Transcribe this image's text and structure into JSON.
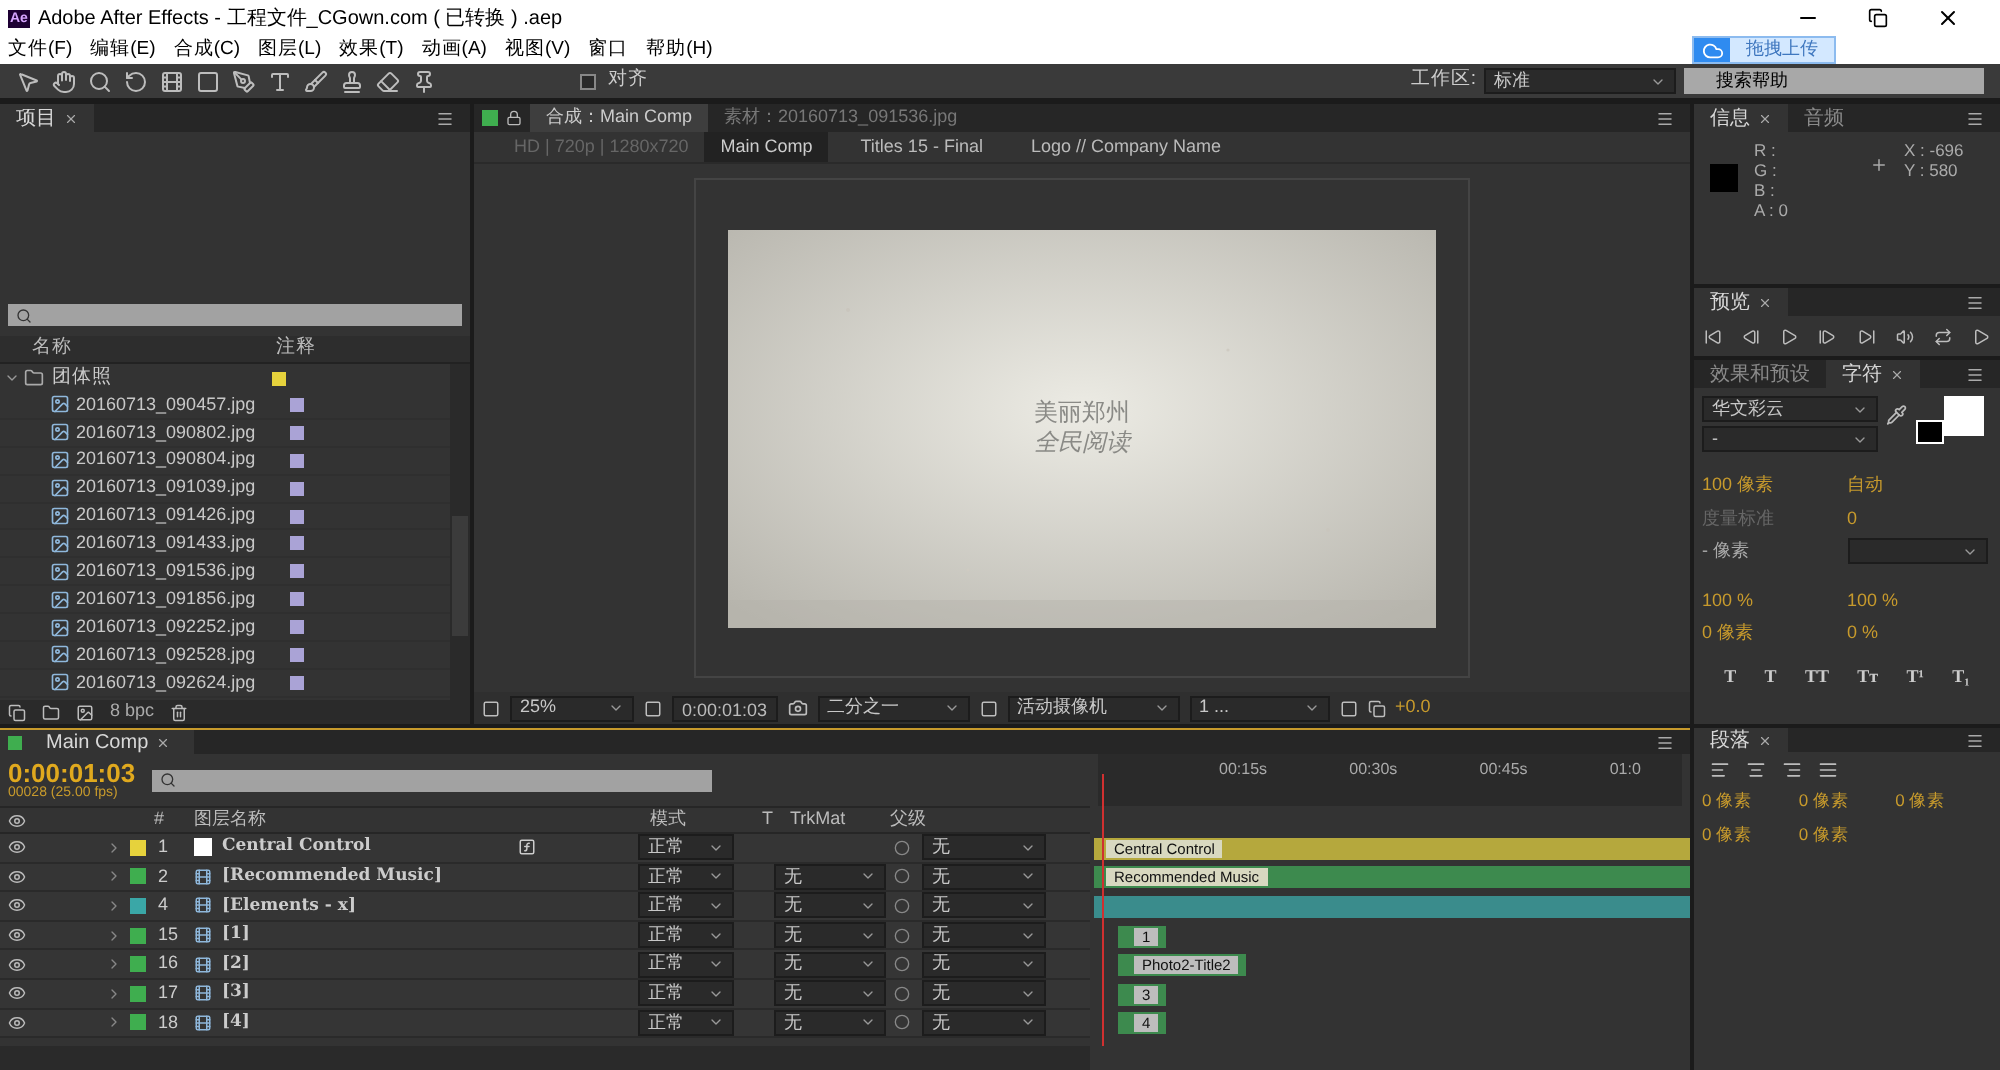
{
  "window": {
    "title": "Adobe After Effects - 工程文件_CGown.com ( 已转换 ) .aep",
    "app_badge": "Ae"
  },
  "menu": [
    "文件(F)",
    "编辑(E)",
    "合成(C)",
    "图层(L)",
    "效果(T)",
    "动画(A)",
    "视图(V)",
    "窗口",
    "帮助(H)"
  ],
  "toolbar": {
    "snap_label": "对齐",
    "snap_checked": false,
    "workspace_label": "工作区:",
    "workspace": "标准",
    "help_search": "搜索帮助"
  },
  "upload_badge": {
    "label": "拖拽上传"
  },
  "project": {
    "tab": "项目",
    "columns": [
      "名称",
      "注释"
    ],
    "folder": {
      "name": "团体照",
      "color": "#e6d23c",
      "expanded": true,
      "children": [
        {
          "name": "20160713_090457.jpg",
          "color": "#aaa3d6"
        },
        {
          "name": "20160713_090802.jpg",
          "color": "#aaa3d6"
        },
        {
          "name": "20160713_090804.jpg",
          "color": "#aaa3d6"
        },
        {
          "name": "20160713_091039.jpg",
          "color": "#aaa3d6"
        },
        {
          "name": "20160713_091426.jpg",
          "color": "#aaa3d6"
        },
        {
          "name": "20160713_091433.jpg",
          "color": "#aaa3d6"
        },
        {
          "name": "20160713_091536.jpg",
          "color": "#aaa3d6"
        },
        {
          "name": "20160713_091856.jpg",
          "color": "#aaa3d6"
        },
        {
          "name": "20160713_092252.jpg",
          "color": "#aaa3d6"
        },
        {
          "name": "20160713_092528.jpg",
          "color": "#aaa3d6"
        },
        {
          "name": "20160713_092624.jpg",
          "color": "#aaa3d6"
        }
      ]
    },
    "bit_depth": "8 bpc"
  },
  "viewer": {
    "tabs": [
      {
        "label": "合成：Main Comp",
        "selected": true
      },
      {
        "label": "素材：20160713_091536.jpg",
        "selected": false
      }
    ],
    "breadcrumb_info": "HD | 720p | 1280x720",
    "breadcrumbs": [
      {
        "label": "Main Comp",
        "selected": true
      },
      {
        "label": "Titles 15 - Final",
        "selected": false
      },
      {
        "label": "Logo // Company Name",
        "selected": false
      }
    ],
    "comp_text": [
      "美丽郑州",
      "全民阅读"
    ],
    "zoom": "25%",
    "timecode": "0:00:01:03",
    "resolution": "二分之一",
    "camera": "活动摄像机",
    "views": "1 ...",
    "exposure": "+0.0"
  },
  "info": {
    "tabs": [
      {
        "label": "信息",
        "selected": true
      },
      {
        "label": "音频",
        "selected": false
      }
    ],
    "rgba": [
      "R :",
      "G :",
      "B :",
      "A : 0"
    ],
    "x": "X : -696",
    "y": "Y : 580"
  },
  "preview": {
    "tab": "预览"
  },
  "character": {
    "tabs": [
      {
        "label": "效果和预设",
        "selected": false
      },
      {
        "label": "字符",
        "selected": true
      }
    ],
    "font": "华文彩云",
    "style": "-",
    "size": "100 像素",
    "leading": "自动",
    "kerning": "度量标准",
    "tracking": "0",
    "stroke": "- 像素",
    "v_scale": "100 %",
    "h_scale": "100 %",
    "baseline": "0 像素",
    "tsume": "0 %",
    "styles": [
      "T",
      "T",
      "TT",
      "Tт",
      "T¹",
      "T₁"
    ]
  },
  "paragraph": {
    "tab": "段落",
    "indents": [
      "0 像素",
      "0 像素",
      "0 像素",
      "0 像素",
      "0 像素"
    ]
  },
  "timeline": {
    "tab": "Main Comp",
    "timecode": "0:00:01:03",
    "frame_info": "00028 (25.00 fps)",
    "columns": [
      "#",
      "图层名称",
      "模式",
      "T",
      "TrkMat",
      "父级"
    ],
    "ruler": [
      "00:15s",
      "00:30s",
      "00:45s",
      "01:0"
    ],
    "layers": [
      {
        "num": "1",
        "name": "Central Control",
        "color": "#e6d23c",
        "kind": "solid",
        "fx": true,
        "mode": "正常",
        "parent": "无",
        "bar": {
          "kind": "full",
          "label": "Central Control",
          "color": "#b5a83d"
        }
      },
      {
        "num": "2",
        "name": "[Recommended Music]",
        "color": "#3fae4f",
        "kind": "comp",
        "fx": false,
        "mode": "正常",
        "trkmat": "无",
        "parent": "无",
        "bar": {
          "kind": "full",
          "label": "Recommended Music",
          "color": "#3d8a4e"
        }
      },
      {
        "num": "4",
        "name": "[Elements - x]",
        "color": "#3aa7a7",
        "kind": "comp",
        "fx": false,
        "mode": "正常",
        "trkmat": "无",
        "parent": "无",
        "bar": {
          "kind": "full",
          "color": "#3a8c8c"
        }
      },
      {
        "num": "15",
        "name": "[1]",
        "color": "#3fae4f",
        "kind": "comp",
        "fx": false,
        "mode": "正常",
        "trkmat": "无",
        "parent": "无",
        "bar": {
          "kind": "clip",
          "label": "1",
          "color": "#3d8a4e"
        }
      },
      {
        "num": "16",
        "name": "[2]",
        "color": "#3fae4f",
        "kind": "comp",
        "fx": false,
        "mode": "正常",
        "trkmat": "无",
        "parent": "无",
        "bar": {
          "kind": "clip",
          "label": "Photo2-Title2",
          "color": "#3d8a4e"
        }
      },
      {
        "num": "17",
        "name": "[3]",
        "color": "#3fae4f",
        "kind": "comp",
        "fx": false,
        "mode": "正常",
        "trkmat": "无",
        "parent": "无",
        "bar": {
          "kind": "clip",
          "label": "3",
          "color": "#3d8a4e"
        }
      },
      {
        "num": "18",
        "name": "[4]",
        "color": "#3fae4f",
        "kind": "comp",
        "fx": false,
        "mode": "正常",
        "trkmat": "无",
        "parent": "无",
        "bar": {
          "kind": "clip",
          "label": "4",
          "color": "#3d8a4e"
        }
      }
    ]
  }
}
